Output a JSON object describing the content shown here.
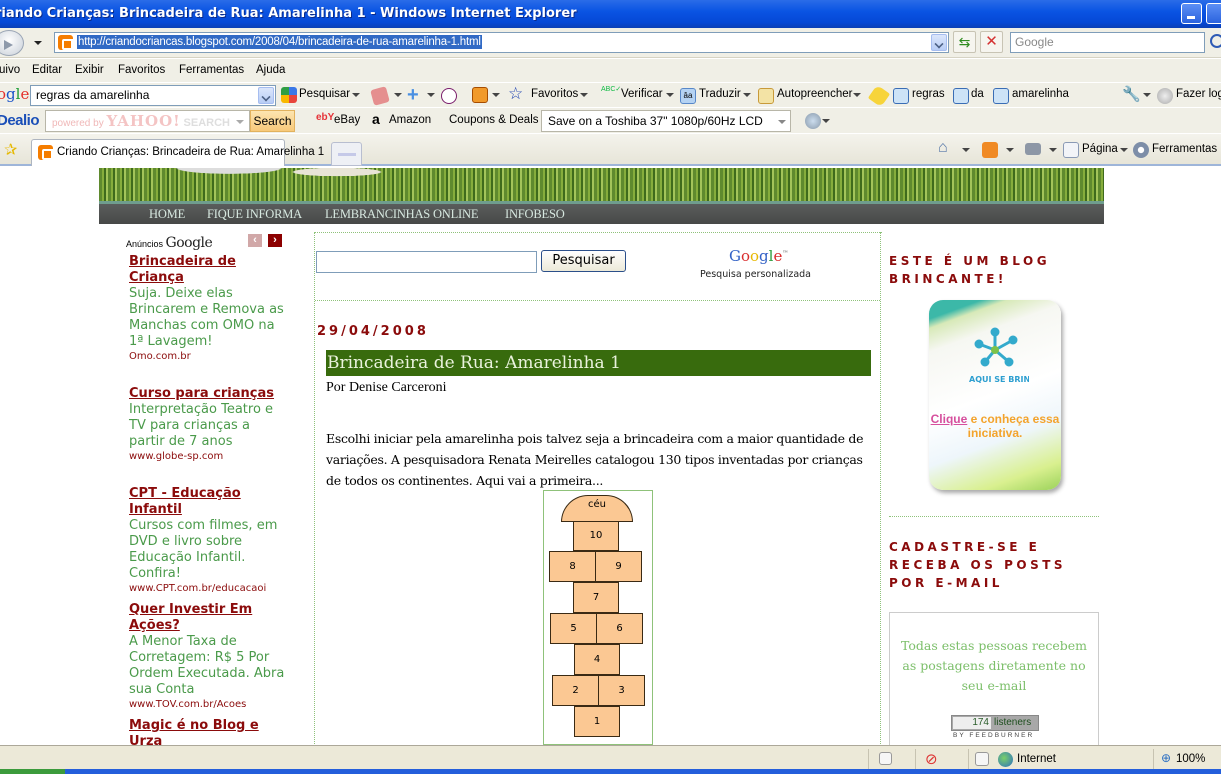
{
  "window": {
    "title": "riando Crianças: Brincadeira de Rua: Amarelinha 1 - Windows Internet Explorer"
  },
  "address_bar": {
    "url": "http://criandocriancas.blogspot.com/2008/04/brincadeira-de-rua-amarelinha-1.html",
    "search_placeholder": "Google"
  },
  "menu": [
    "uivo",
    "Editar",
    "Exibir",
    "Favoritos",
    "Ferramentas",
    "Ajuda"
  ],
  "google_toolbar": {
    "logo": "ogle",
    "query": "regras da amarelinha",
    "search_label": "Pesquisar",
    "favorites_label": "Favoritos",
    "check_label": "Verificar",
    "translate_label": "Traduzir",
    "autofill_label": "Autopreencher",
    "highlight_terms": [
      "regras",
      "da",
      "amarelinha"
    ],
    "login_label": "Fazer log"
  },
  "dealio_toolbar": {
    "logo": "Dealio",
    "search_placeholder": "powered by YAHOO! SEARCH",
    "search_button": "Search",
    "links": [
      "eBay",
      "Amazon",
      "Coupons & Deals"
    ],
    "deal_select": "Save on a Toshiba 37\" 1080p/60Hz LCD"
  },
  "tabs": {
    "active_tab": "Criando Crianças: Brincadeira de Rua: Amarelinha 1",
    "page_label": "Página",
    "tools_label": "Ferramentas"
  },
  "blog": {
    "nav": [
      "HOME",
      "FIQUE INFORMA",
      "LEMBRANCINHAS ONLINE",
      "INFOBESO"
    ],
    "ads_label": "Anúncios",
    "ads_brand": "Google",
    "ads": [
      {
        "title": "Brincadeira de Criança",
        "desc": "Suja. Deixe elas Brincarem e Remova as Manchas com OMO na 1ª Lavagem!",
        "url": "Omo.com.br"
      },
      {
        "title": "Curso para crianças",
        "desc": "Interpretação Teatro e TV para crianças a partir de 7 anos",
        "url": "www.globe-sp.com"
      },
      {
        "title": "CPT - Educação Infantil",
        "desc": "Cursos com filmes, em DVD e livro sobre Educação Infantil. Confira!",
        "url": "www.CPT.com.br/educacaoi"
      },
      {
        "title": "Quer Investir Em Ações?",
        "desc": "A Menor Taxa de Corretagem: R$ 5 Por Ordem Executada. Abra sua Conta",
        "url": "www.TOV.com.br/Acoes"
      },
      {
        "title": "Magic é no Blog e Urza",
        "desc": "",
        "url": ""
      }
    ],
    "cse": {
      "button": "Pesquisar",
      "brand": "Google",
      "caption": "Pesquisa personalizada"
    },
    "post": {
      "date": "29/04/2008",
      "title": "Brincadeira de Rua: Amarelinha 1",
      "byline": "Por Denise Carceroni",
      "body": "Escolhi iniciar pela amarelinha pois talvez seja a brincadeira com a maior quantidade de variações. A pesquisadora Renata Meirelles catalogou 130 tipos inventadas por crianças de todos os continentes. Aqui vai a primeira...",
      "hopscotch": [
        "céu",
        "10",
        "8",
        "9",
        "7",
        "5",
        "6",
        "4",
        "2",
        "3",
        "1"
      ]
    },
    "sidebar": {
      "heading1": "ESTE É UM BLOG BRINCANTE!",
      "badge_logo": "AQUI SE BRINCA",
      "badge_link": "Clique",
      "badge_text": " e conheça essa iniciativa.",
      "heading2": "CADASTRE-SE E RECEBA OS POSTS POR E-MAIL",
      "subscribe_text": "Todas estas pessoas recebem as postagens diretamente no seu e-mail",
      "listeners_count": "174",
      "listeners_label": "listeners",
      "feedburner": "BY FEEDBURNER"
    }
  },
  "status_bar": {
    "zone": "Internet",
    "zoom": "100%"
  }
}
